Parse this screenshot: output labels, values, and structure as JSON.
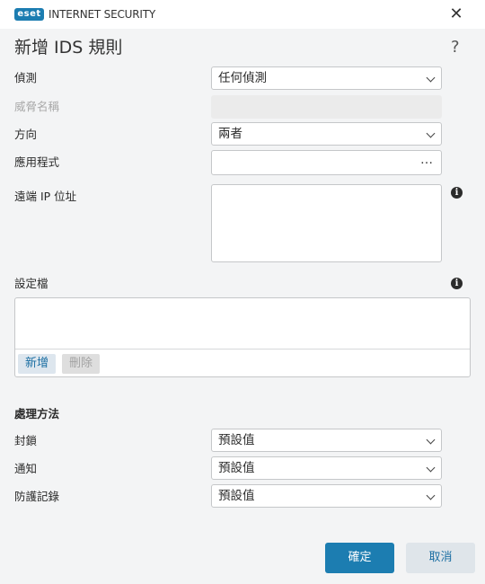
{
  "titlebar": {
    "logo": "eset",
    "product": "INTERNET SECURITY",
    "close_icon": "close-icon"
  },
  "dialog": {
    "title": "新增 IDS 規則",
    "help": "?"
  },
  "form": {
    "detection": {
      "label": "偵測",
      "value": "任何偵測"
    },
    "threat_name": {
      "label": "威脅名稱",
      "value": ""
    },
    "direction": {
      "label": "方向",
      "value": "兩者"
    },
    "application": {
      "label": "應用程式",
      "value": "",
      "browse": "…"
    },
    "remote_ip": {
      "label": "遠端 IP 位址",
      "value": ""
    }
  },
  "profiles": {
    "label": "設定檔",
    "add_label": "新增",
    "delete_label": "刪除"
  },
  "actions": {
    "section_title": "處理方法",
    "block": {
      "label": "封鎖",
      "value": "預設值"
    },
    "notify": {
      "label": "通知",
      "value": "預設值"
    },
    "log": {
      "label": "防護記錄",
      "value": "預設值"
    }
  },
  "footer": {
    "ok_label": "確定",
    "cancel_label": "取消"
  },
  "colors": {
    "accent": "#1c7db1",
    "background": "#f3f4f5"
  }
}
